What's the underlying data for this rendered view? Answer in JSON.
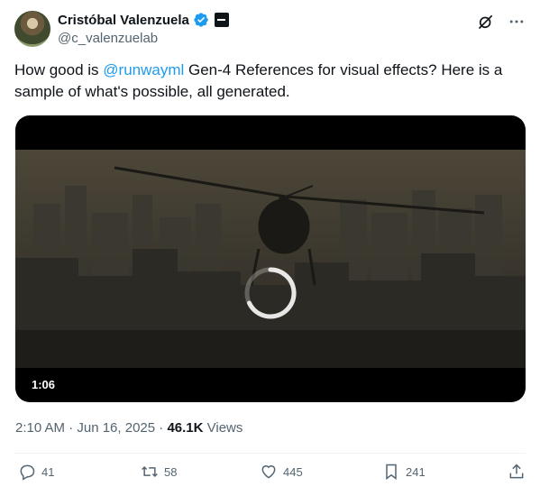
{
  "author": {
    "display_name": "Cristóbal Valenzuela",
    "handle": "@c_valenzuelab"
  },
  "tweet": {
    "text_before": "How good is ",
    "mention": "@runwayml",
    "text_after": " Gen-4 References for visual effects? Here is a sample of what's possible, all generated."
  },
  "media": {
    "duration": "1:06"
  },
  "meta": {
    "timestamp": "2:10 AM · Jun 16, 2025 · ",
    "views_count": "46.1K",
    "views_label": " Views"
  },
  "actions": {
    "replies": "41",
    "reposts": "58",
    "likes": "445",
    "bookmarks": "241"
  },
  "colors": {
    "accent": "#1d9bf0",
    "text": "#0f1419",
    "secondary": "#536471"
  }
}
